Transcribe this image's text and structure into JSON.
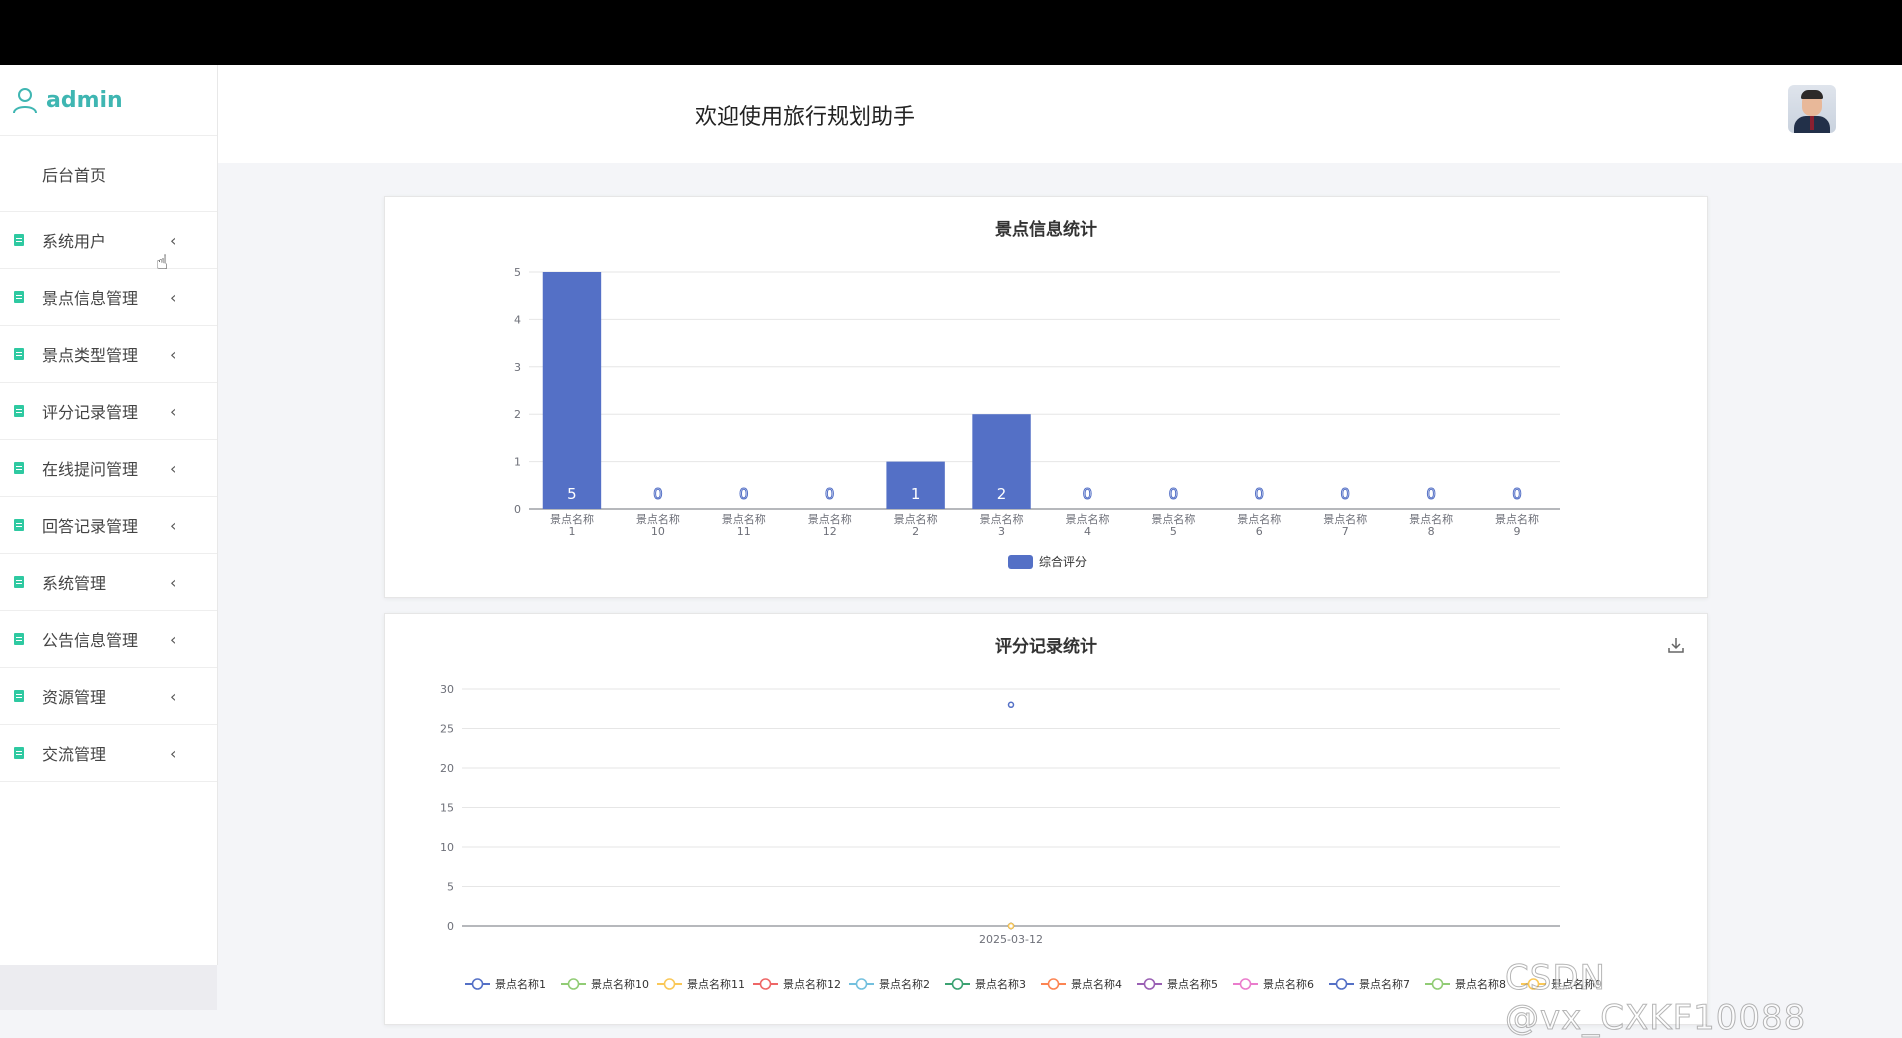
{
  "app": {
    "user": "admin",
    "welcome": "欢迎使用旅行规划助手"
  },
  "sidebar": {
    "home": "后台首页",
    "items": [
      {
        "label": "系统用户"
      },
      {
        "label": "景点信息管理"
      },
      {
        "label": "景点类型管理"
      },
      {
        "label": "评分记录管理"
      },
      {
        "label": "在线提问管理"
      },
      {
        "label": "回答记录管理"
      },
      {
        "label": "系统管理"
      },
      {
        "label": "公告信息管理"
      },
      {
        "label": "资源管理"
      },
      {
        "label": "交流管理"
      }
    ]
  },
  "icons": {
    "user": "user-icon",
    "doc": "document-icon",
    "chevron": "chevron-left-icon",
    "download": "download-icon",
    "avatar": "avatar-photo"
  },
  "colors": {
    "accent": "#3fb6b2",
    "menu_icon": "#2ec9a1",
    "bar": "#5470c6"
  },
  "watermark": "CSDN @vx_CXKF10088",
  "chart_data": [
    {
      "type": "bar",
      "title": "景点信息统计",
      "categories": [
        "景点名称1",
        "景点名称10",
        "景点名称11",
        "景点名称12",
        "景点名称2",
        "景点名称3",
        "景点名称4",
        "景点名称5",
        "景点名称6",
        "景点名称7",
        "景点名称8",
        "景点名称9"
      ],
      "series": [
        {
          "name": "综合评分",
          "values": [
            5,
            0,
            0,
            0,
            1,
            2,
            0,
            0,
            0,
            0,
            0,
            0
          ]
        }
      ],
      "ylim": [
        0,
        5
      ],
      "yticks": [
        0,
        1,
        2,
        3,
        4,
        5
      ],
      "grid": true,
      "legend": "bottom"
    },
    {
      "type": "line",
      "title": "评分记录统计",
      "x": [
        "2025-03-12"
      ],
      "ylim": [
        0,
        30
      ],
      "yticks": [
        0,
        5,
        10,
        15,
        20,
        25,
        30
      ],
      "grid": true,
      "legend": "bottom",
      "series": [
        {
          "name": "景点名称1",
          "values": [
            28
          ],
          "color": "#5470c6"
        },
        {
          "name": "景点名称10",
          "values": [
            0
          ],
          "color": "#91cc75"
        },
        {
          "name": "景点名称11",
          "values": [
            0
          ],
          "color": "#fac858"
        },
        {
          "name": "景点名称12",
          "values": [
            0
          ],
          "color": "#ee6666"
        },
        {
          "name": "景点名称2",
          "values": [
            0
          ],
          "color": "#73c0de"
        },
        {
          "name": "景点名称3",
          "values": [
            0
          ],
          "color": "#3ba272"
        },
        {
          "name": "景点名称4",
          "values": [
            0
          ],
          "color": "#fc8452"
        },
        {
          "name": "景点名称5",
          "values": [
            0
          ],
          "color": "#9a60b4"
        },
        {
          "name": "景点名称6",
          "values": [
            0
          ],
          "color": "#ea7ccc"
        },
        {
          "name": "景点名称7",
          "values": [
            0
          ],
          "color": "#5470c6"
        },
        {
          "name": "景点名称8",
          "values": [
            0
          ],
          "color": "#91cc75"
        },
        {
          "name": "景点名称9",
          "values": [
            0
          ],
          "color": "#fac858"
        }
      ]
    }
  ]
}
